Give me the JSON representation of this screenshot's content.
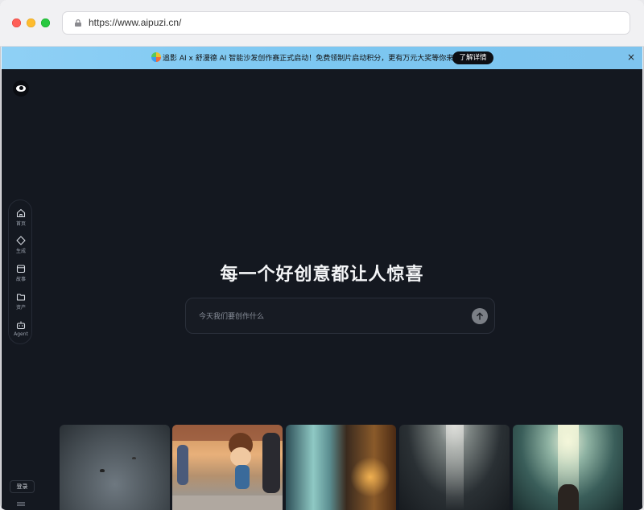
{
  "browser": {
    "url": "https://www.aipuzi.cn/"
  },
  "banner": {
    "text": "追影 AI x 舒漫德 AI 智能沙发创作赛正式启动！免费领制片启动积分，更有万元大奖等你来战",
    "button_label": "了解详情",
    "close_label": "×"
  },
  "sidebar": {
    "items": [
      {
        "label": "首页",
        "icon": "home-icon"
      },
      {
        "label": "生成",
        "icon": "diamond-icon"
      },
      {
        "label": "故事",
        "icon": "calendar-icon"
      },
      {
        "label": "资产",
        "icon": "folder-icon"
      },
      {
        "label": "Agent",
        "icon": "robot-icon"
      }
    ],
    "login_label": "登录"
  },
  "main": {
    "headline": "每一个好创意都让人惊喜",
    "prompt_placeholder": "今天我们要创作什么"
  },
  "colors": {
    "background": "#141820",
    "banner": "#8fd0f5",
    "accent_button": "#0d0f14"
  }
}
